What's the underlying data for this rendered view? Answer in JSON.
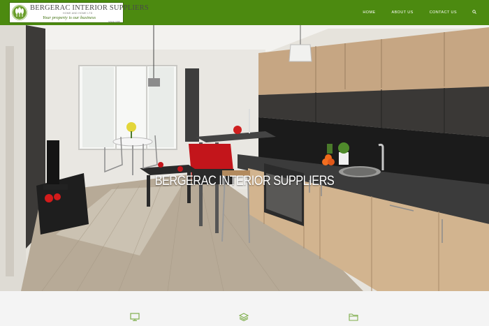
{
  "brand": {
    "name": "BERGERAC  INTERIOR SUPPLIERS",
    "subtitle": "HOME AND HOME LTD",
    "tagline": "Your property is our business",
    "since": "SINCE 1998"
  },
  "nav": {
    "items": [
      "HOME",
      "ABOUT US",
      "CONTACT US"
    ],
    "search_icon": "search-icon"
  },
  "hero": {
    "title": "BERGERAC INTERIOR SUPPLIERS",
    "image": "modern-kitchen-photo"
  },
  "features": {
    "icons": [
      "monitor-icon",
      "layers-icon",
      "folder-icon"
    ]
  },
  "colors": {
    "brand_green": "#4c8a10",
    "footer_icon_green": "#7fae4d"
  }
}
